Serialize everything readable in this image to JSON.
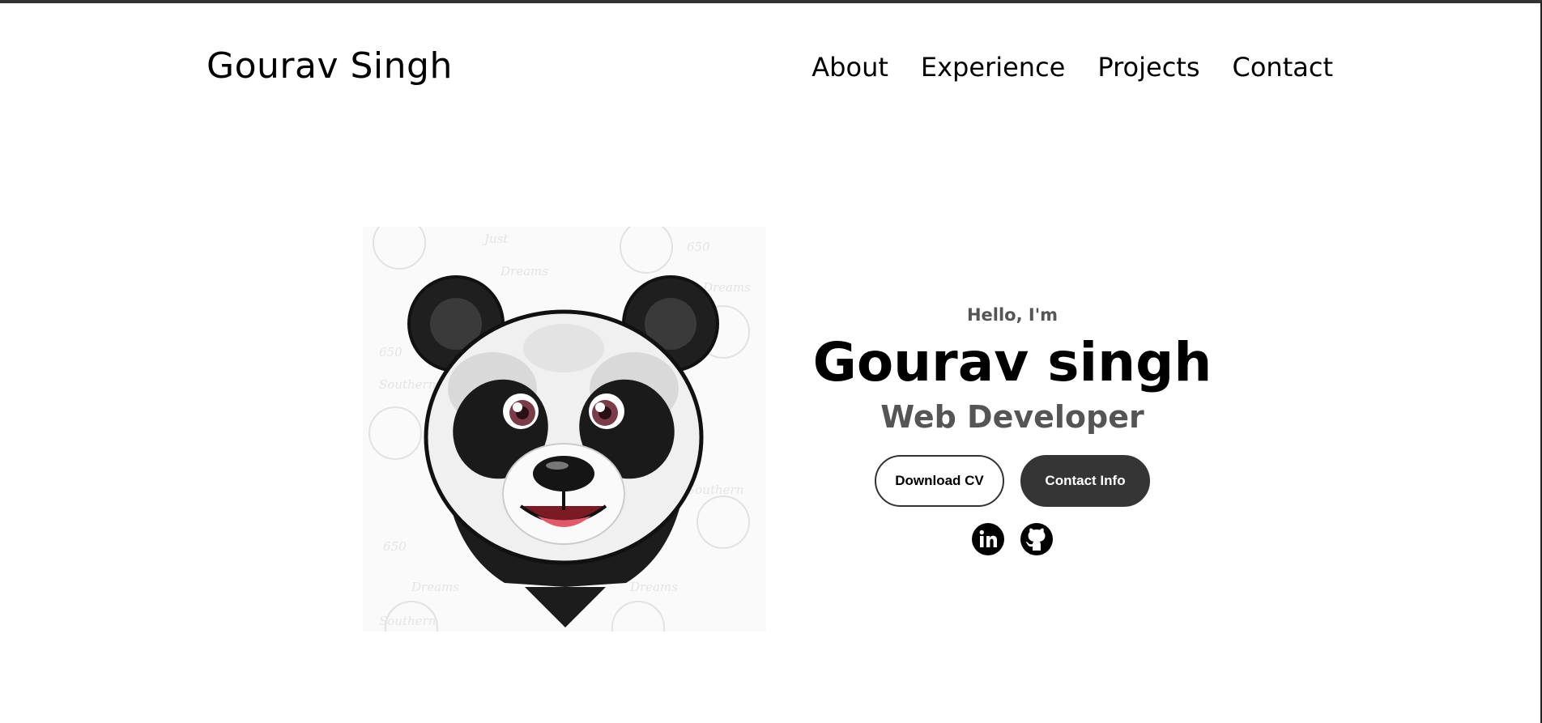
{
  "nav": {
    "logo": "Gourav Singh",
    "links": [
      "About",
      "Experience",
      "Projects",
      "Contact"
    ]
  },
  "hero": {
    "greeting": "Hello, I'm",
    "name": "Gourav singh",
    "role": "Web Developer",
    "buttons": {
      "download": "Download CV",
      "contact": "Contact Info"
    },
    "image": {
      "subject": "panda-mascot-illustration"
    },
    "socials": [
      {
        "icon": "linkedin-icon"
      },
      {
        "icon": "github-icon"
      }
    ]
  },
  "colors": {
    "text": "#000000",
    "muted": "#555555",
    "button_dark": "#353535",
    "background": "#ffffff"
  }
}
